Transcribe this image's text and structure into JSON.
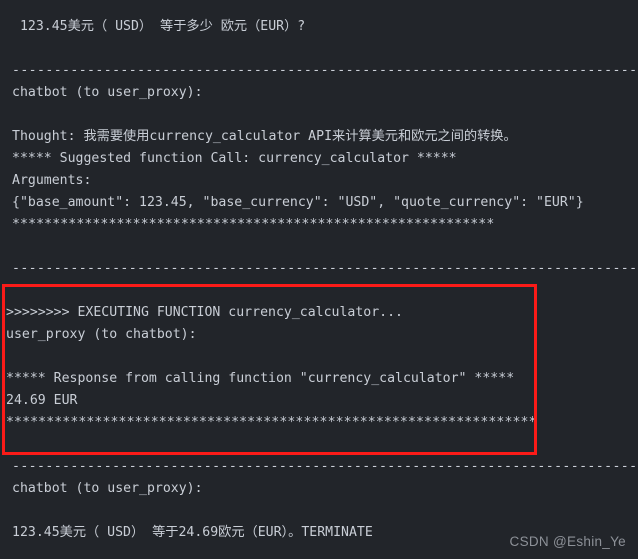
{
  "terminal": {
    "background_color": "#22252a",
    "text_color": "#c9ced6",
    "highlight_color": "#fb1b18",
    "lines": [
      {
        "id": "l01",
        "text": " 123.45美元（ USD） 等于多少 欧元（EUR）?",
        "kind": "text"
      },
      {
        "id": "l02",
        "text": "",
        "kind": "blank"
      },
      {
        "id": "l03",
        "text": "--------------------------------------------------------------------------------",
        "kind": "separator"
      },
      {
        "id": "l04",
        "text": "chatbot (to user_proxy):",
        "kind": "text"
      },
      {
        "id": "l05",
        "text": "",
        "kind": "blank"
      },
      {
        "id": "l06",
        "text": "Thought: 我需要使用currency_calculator API来计算美元和欧元之间的转换。",
        "kind": "text"
      },
      {
        "id": "l07",
        "text": "***** Suggested function Call: currency_calculator *****",
        "kind": "text"
      },
      {
        "id": "l08",
        "text": "Arguments:",
        "kind": "text"
      },
      {
        "id": "l09",
        "text": "{\"base_amount\": 123.45, \"base_currency\": \"USD\", \"quote_currency\": \"EUR\"}",
        "kind": "text"
      },
      {
        "id": "l10",
        "text": "************************************************************",
        "kind": "stars"
      },
      {
        "id": "l11",
        "text": "",
        "kind": "blank"
      },
      {
        "id": "l12",
        "text": "--------------------------------------------------------------------------------",
        "kind": "separator"
      },
      {
        "id": "l13",
        "text": "",
        "kind": "blank"
      },
      {
        "id": "l14",
        "text": ">>>>>>>> EXECUTING FUNCTION currency_calculator...",
        "kind": "text"
      },
      {
        "id": "l15",
        "text": "user_proxy (to chatbot):",
        "kind": "text"
      },
      {
        "id": "l16",
        "text": "",
        "kind": "blank"
      },
      {
        "id": "l17",
        "text": "***** Response from calling function \"currency_calculator\" *****",
        "kind": "text"
      },
      {
        "id": "l18",
        "text": "24.69 EUR",
        "kind": "text"
      },
      {
        "id": "l19",
        "text": "******************************************************************",
        "kind": "stars"
      },
      {
        "id": "l20",
        "text": "",
        "kind": "blank"
      },
      {
        "id": "l21",
        "text": "--------------------------------------------------------------------------------",
        "kind": "separator"
      },
      {
        "id": "l22",
        "text": "chatbot (to user_proxy):",
        "kind": "text"
      },
      {
        "id": "l23",
        "text": "",
        "kind": "blank"
      },
      {
        "id": "l24",
        "text": "123.45美元（ USD） 等于24.69欧元（EUR）。TERMINATE",
        "kind": "text"
      }
    ]
  },
  "annotation": {
    "box_label": "executing-function-highlight",
    "color": "#fb1b18"
  },
  "watermark": {
    "text": "CSDN @Eshin_Ye"
  }
}
